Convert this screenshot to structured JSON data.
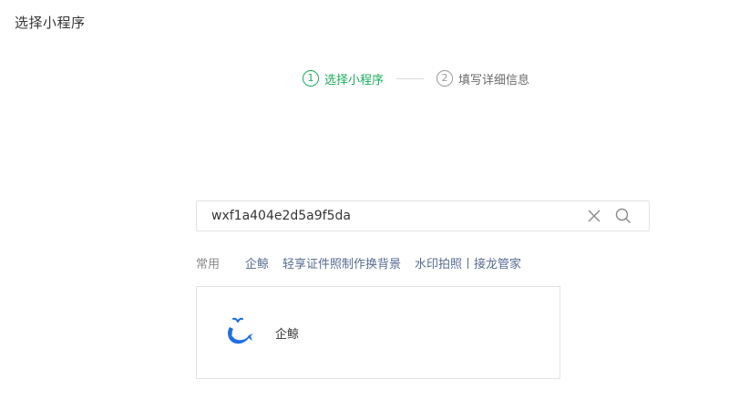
{
  "page_title": "选择小程序",
  "steps": [
    {
      "number": "1",
      "label": "选择小程序",
      "state": "active"
    },
    {
      "number": "2",
      "label": "填写详细信息",
      "state": "inactive"
    }
  ],
  "search": {
    "value": "wxf1a404e2d5a9f5da"
  },
  "recent": {
    "label": "常用",
    "items": [
      "企鲸",
      "轻享证件照制作换背景",
      "水印拍照丨接龙管家"
    ]
  },
  "result": {
    "name": "企鲸"
  },
  "colors": {
    "accent": "#1aad5b",
    "link": "#576b95",
    "logo": "#1e6fe8"
  },
  "icons": {
    "clear": "close-icon",
    "search": "search-icon",
    "logo": "whale-logo"
  }
}
